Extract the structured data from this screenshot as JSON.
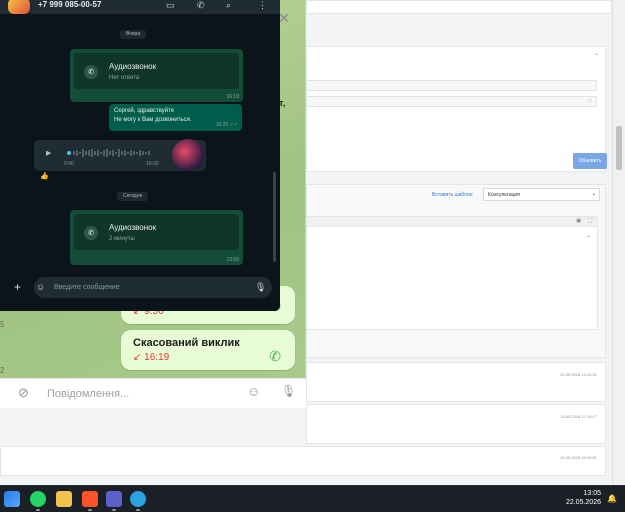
{
  "whatsapp": {
    "contact": "+7 999 085-00-57",
    "header_icons": [
      "video-icon",
      "phone-icon",
      "search-icon",
      "more-icon"
    ],
    "day_yesterday": "Вчера",
    "day_today": "Сегодня",
    "call1": {
      "title": "Аудиозвонок",
      "status": "Нет ответа",
      "time": "16:19"
    },
    "text_message": {
      "line1": "Сергей, здравствуйте",
      "line2": "Не могу к Вам дозвониться.",
      "time": "16:20"
    },
    "voice": {
      "duration": "0:40",
      "time": "19:00",
      "reaction": "👍"
    },
    "call2": {
      "title": "Аудиозвонок",
      "status": "2 минуты",
      "time": "13:05"
    },
    "compose_placeholder": "Введите сообщение"
  },
  "telegram": {
    "bubble1_time": "9:56",
    "bubble2_title": "Скасований виклик",
    "bubble2_time": "16:19",
    "compose_placeholder": "Повідомлення...",
    "partial_chars": {
      "t_comma": "т,",
      "c_comma": "...",
      "num5": "5",
      "num2": "2"
    }
  },
  "crm": {
    "refresh_button": "Обновить",
    "template_link": "Вставить шаблон",
    "template_select": "Консультация",
    "dates": [
      "22.05.2026 13:15:31",
      "13.05.2026 17:19:17",
      "10.05.2026 15:06:01"
    ]
  },
  "taskbar": {
    "time": "13:05",
    "date": "22.05.2026"
  }
}
